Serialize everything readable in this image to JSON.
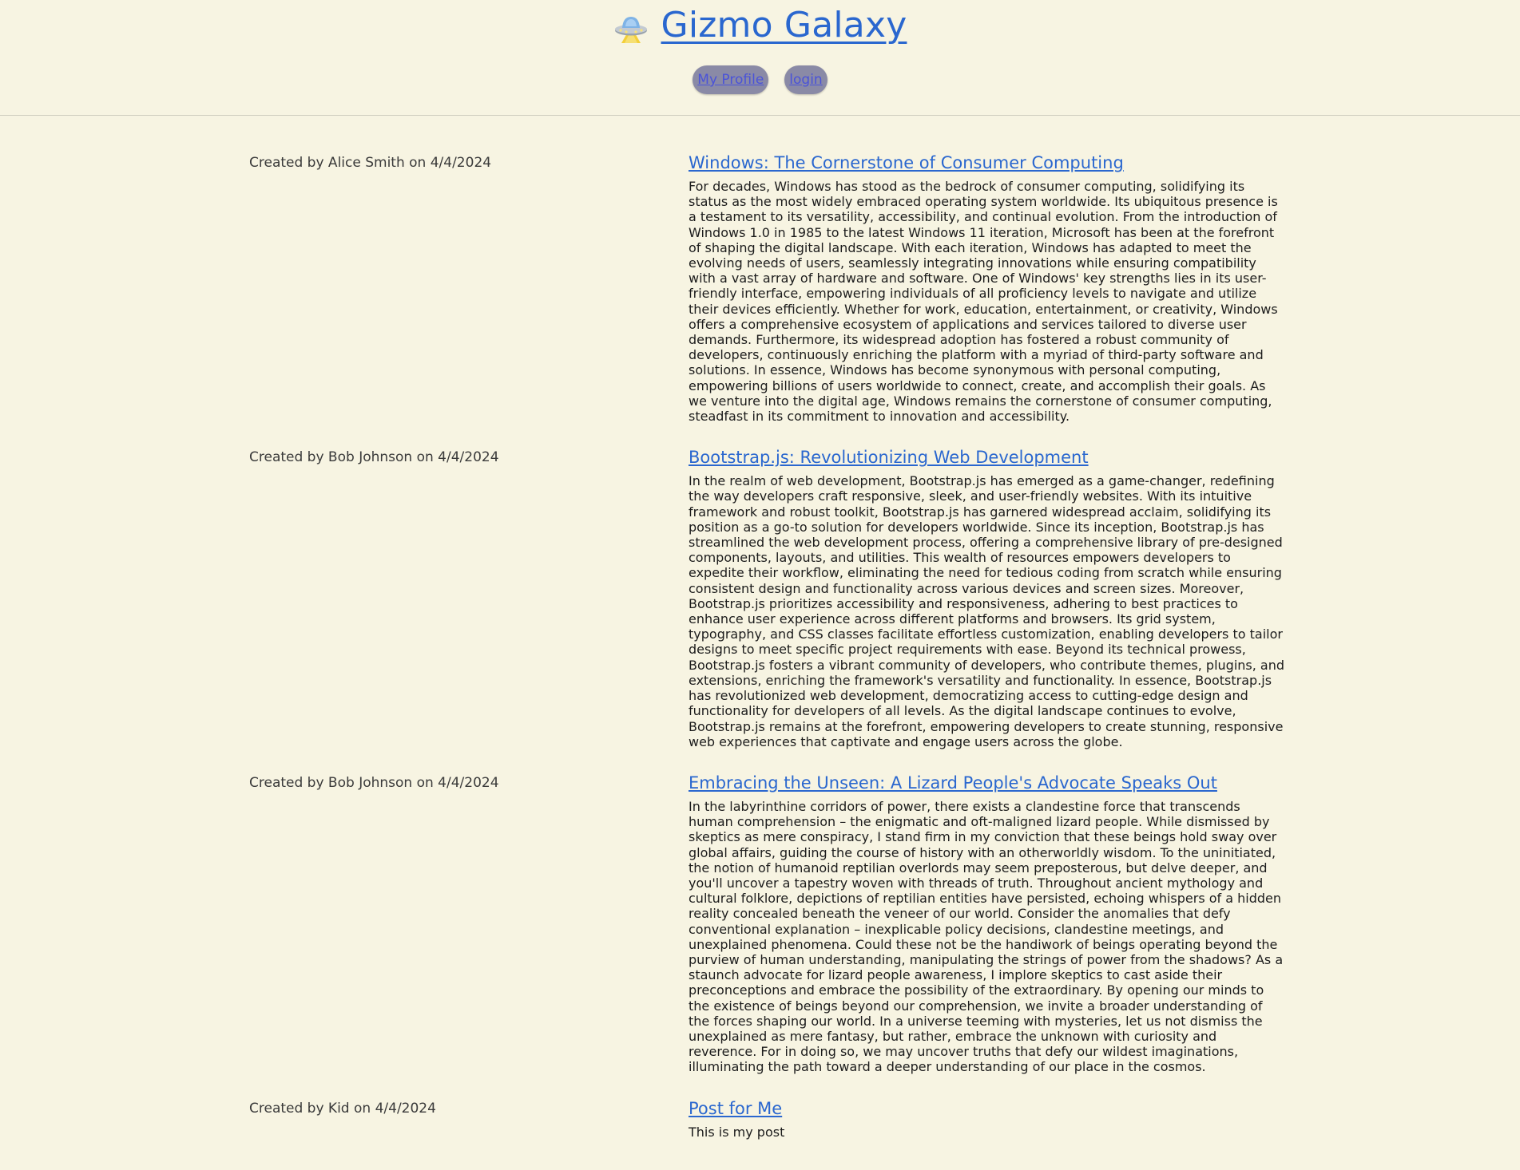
{
  "header": {
    "title": "Gizmo Galaxy",
    "logo_icon": "ufo-icon",
    "nav": [
      {
        "label": "My Profile"
      },
      {
        "label": "login"
      }
    ]
  },
  "colors": {
    "background": "#f7f4e2",
    "link": "#2a67cf",
    "nav_pill": "#8a8aa6"
  },
  "posts": [
    {
      "meta": "Created by Alice Smith on 4/4/2024",
      "title": "Windows: The Cornerstone of Consumer Computing",
      "body": "For decades, Windows has stood as the bedrock of consumer computing, solidifying its status as the most widely embraced operating system worldwide. Its ubiquitous presence is a testament to its versatility, accessibility, and continual evolution. From the introduction of Windows 1.0 in 1985 to the latest Windows 11 iteration, Microsoft has been at the forefront of shaping the digital landscape. With each iteration, Windows has adapted to meet the evolving needs of users, seamlessly integrating innovations while ensuring compatibility with a vast array of hardware and software. One of Windows' key strengths lies in its user-friendly interface, empowering individuals of all proficiency levels to navigate and utilize their devices efficiently. Whether for work, education, entertainment, or creativity, Windows offers a comprehensive ecosystem of applications and services tailored to diverse user demands. Furthermore, its widespread adoption has fostered a robust community of developers, continuously enriching the platform with a myriad of third-party software and solutions. In essence, Windows has become synonymous with personal computing, empowering billions of users worldwide to connect, create, and accomplish their goals. As we venture into the digital age, Windows remains the cornerstone of consumer computing, steadfast in its commitment to innovation and accessibility."
    },
    {
      "meta": "Created by Bob Johnson on 4/4/2024",
      "title": "Bootstrap.js: Revolutionizing Web Development",
      "body": "In the realm of web development, Bootstrap.js has emerged as a game-changer, redefining the way developers craft responsive, sleek, and user-friendly websites. With its intuitive framework and robust toolkit, Bootstrap.js has garnered widespread acclaim, solidifying its position as a go-to solution for developers worldwide. Since its inception, Bootstrap.js has streamlined the web development process, offering a comprehensive library of pre-designed components, layouts, and utilities. This wealth of resources empowers developers to expedite their workflow, eliminating the need for tedious coding from scratch while ensuring consistent design and functionality across various devices and screen sizes. Moreover, Bootstrap.js prioritizes accessibility and responsiveness, adhering to best practices to enhance user experience across different platforms and browsers. Its grid system, typography, and CSS classes facilitate effortless customization, enabling developers to tailor designs to meet specific project requirements with ease. Beyond its technical prowess, Bootstrap.js fosters a vibrant community of developers, who contribute themes, plugins, and extensions, enriching the framework's versatility and functionality. In essence, Bootstrap.js has revolutionized web development, democratizing access to cutting-edge design and functionality for developers of all levels. As the digital landscape continues to evolve, Bootstrap.js remains at the forefront, empowering developers to create stunning, responsive web experiences that captivate and engage users across the globe."
    },
    {
      "meta": "Created by Bob Johnson on 4/4/2024",
      "title": "Embracing the Unseen: A Lizard People's Advocate Speaks Out",
      "body": "In the labyrinthine corridors of power, there exists a clandestine force that transcends human comprehension – the enigmatic and oft-maligned lizard people. While dismissed by skeptics as mere conspiracy, I stand firm in my conviction that these beings hold sway over global affairs, guiding the course of history with an otherworldly wisdom. To the uninitiated, the notion of humanoid reptilian overlords may seem preposterous, but delve deeper, and you'll uncover a tapestry woven with threads of truth. Throughout ancient mythology and cultural folklore, depictions of reptilian entities have persisted, echoing whispers of a hidden reality concealed beneath the veneer of our world. Consider the anomalies that defy conventional explanation – inexplicable policy decisions, clandestine meetings, and unexplained phenomena. Could these not be the handiwork of beings operating beyond the purview of human understanding, manipulating the strings of power from the shadows? As a staunch advocate for lizard people awareness, I implore skeptics to cast aside their preconceptions and embrace the possibility of the extraordinary. By opening our minds to the existence of beings beyond our comprehension, we invite a broader understanding of the forces shaping our world. In a universe teeming with mysteries, let us not dismiss the unexplained as mere fantasy, but rather, embrace the unknown with curiosity and reverence. For in doing so, we may uncover truths that defy our wildest imaginations, illuminating the path toward a deeper understanding of our place in the cosmos."
    },
    {
      "meta": "Created by Kid on 4/4/2024",
      "title": "Post for Me",
      "body": "This is my post"
    }
  ]
}
